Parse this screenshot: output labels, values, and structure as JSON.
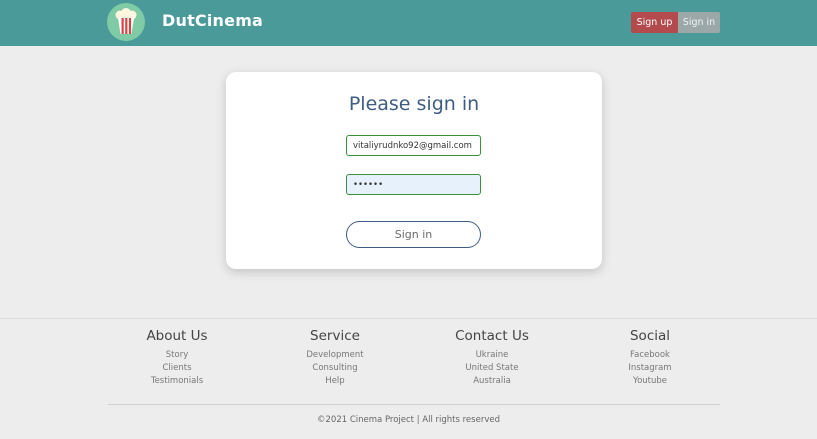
{
  "header": {
    "brand": "DutCinema",
    "logo_icon": "popcorn-icon",
    "signup_label": "Sign up",
    "signin_label": "Sign in",
    "bg_color": "#4a9a9a",
    "signup_color": "#b34a4e"
  },
  "form": {
    "title": "Please sign in",
    "email_value": "vitaliyrudnko92@gmail.com",
    "password_value": "••••••",
    "submit_label": "Sign in"
  },
  "footer": {
    "columns": [
      {
        "title": "About Us",
        "links": [
          "Story",
          "Clients",
          "Testimonials"
        ]
      },
      {
        "title": "Service",
        "links": [
          "Development",
          "Consulting",
          "Help"
        ]
      },
      {
        "title": "Contact Us",
        "links": [
          "Ukraine",
          "United State",
          "Australia"
        ]
      },
      {
        "title": "Social",
        "links": [
          "Facebook",
          "Instagram",
          "Youtube"
        ]
      }
    ],
    "copyright": "©2021 Cinema Project | All rights reserved"
  }
}
